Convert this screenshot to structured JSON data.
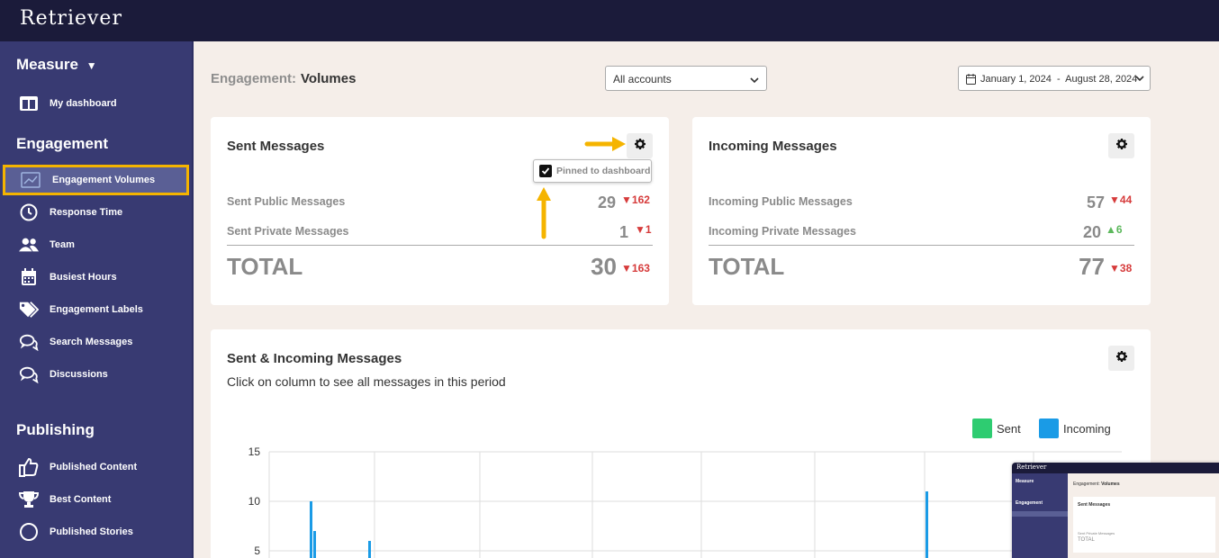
{
  "brand": {
    "logo_text": "Retriever"
  },
  "sidebar": {
    "measure_label": "Measure",
    "engagement_label": "Engagement",
    "publishing_label": "Publishing",
    "items": [
      {
        "label": "My dashboard",
        "icon": "dashboard-icon"
      },
      {
        "label": "Engagement Volumes",
        "icon": "chart-icon",
        "active": true
      },
      {
        "label": "Response Time",
        "icon": "clock-icon"
      },
      {
        "label": "Team",
        "icon": "team-icon"
      },
      {
        "label": "Busiest Hours",
        "icon": "calendar-icon"
      },
      {
        "label": "Engagement Labels",
        "icon": "tags-icon"
      },
      {
        "label": "Search Messages",
        "icon": "chat-icon"
      },
      {
        "label": "Discussions",
        "icon": "chat-icon"
      },
      {
        "label": "Published Content",
        "icon": "thumbs-up-icon"
      },
      {
        "label": "Best Content",
        "icon": "trophy-icon"
      },
      {
        "label": "Published Stories",
        "icon": "circle-icon"
      }
    ]
  },
  "header": {
    "title_prefix": "Engagement:",
    "title_main": "Volumes",
    "account_select": "All accounts",
    "date_range": "January 1, 2024  -  August 28, 2024"
  },
  "sent_card": {
    "title": "Sent Messages",
    "pinned_label": "Pinned to dashboard",
    "pinned_checked": true,
    "rows": [
      {
        "label": "Sent Public Messages",
        "value": "29",
        "delta": "162",
        "direction": "down"
      },
      {
        "label": "Sent Private Messages",
        "value": "1",
        "delta": "1",
        "direction": "down"
      }
    ],
    "total_label": "TOTAL",
    "total_value": "30",
    "total_delta": "163",
    "total_direction": "down"
  },
  "incoming_card": {
    "title": "Incoming Messages",
    "rows": [
      {
        "label": "Incoming Public Messages",
        "value": "57",
        "delta": "44",
        "direction": "down"
      },
      {
        "label": "Incoming Private Messages",
        "value": "20",
        "delta": "6",
        "direction": "up"
      }
    ],
    "total_label": "TOTAL",
    "total_value": "77",
    "total_delta": "38",
    "total_direction": "down"
  },
  "chart_card": {
    "title": "Sent & Incoming Messages",
    "subtitle": "Click on column to see all messages in this period"
  },
  "colors": {
    "sent": "#2ecc71",
    "incoming": "#1a9be6",
    "down": "#d63b3b",
    "up": "#5cb85c",
    "highlight": "#f5b400"
  },
  "chart_data": {
    "type": "bar",
    "yticks": [
      15,
      10,
      5
    ],
    "ylim": [
      0,
      15
    ],
    "series": [
      {
        "name": "Sent",
        "values": []
      },
      {
        "name": "Incoming",
        "values": [
          10,
          7,
          6,
          11
        ]
      }
    ],
    "legend": [
      "Sent",
      "Incoming"
    ],
    "legend_position": "top-right"
  }
}
